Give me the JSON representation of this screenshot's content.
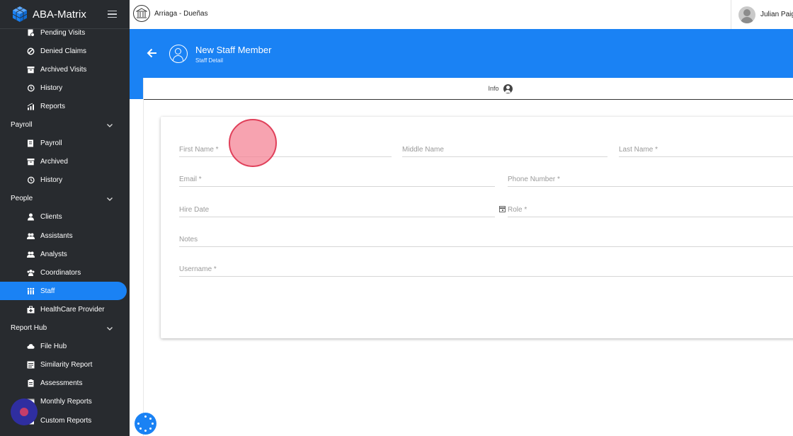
{
  "app": {
    "name": "ABA-Matrix"
  },
  "sidebar": {
    "items": [
      {
        "label": "Pending Visits",
        "icon": "pending-visits-icon"
      },
      {
        "label": "Denied Claims",
        "icon": "denied-icon"
      },
      {
        "label": "Archived Visits",
        "icon": "archive-icon"
      },
      {
        "label": "History",
        "icon": "history-icon"
      },
      {
        "label": "Reports",
        "icon": "reports-icon"
      }
    ],
    "payroll_section": "Payroll",
    "payroll_items": [
      {
        "label": "Payroll",
        "icon": "payroll-icon"
      },
      {
        "label": "Archived",
        "icon": "archive-icon"
      },
      {
        "label": "History",
        "icon": "history-icon"
      }
    ],
    "people_section": "People",
    "people_items": [
      {
        "label": "Clients",
        "icon": "client-icon"
      },
      {
        "label": "Assistants",
        "icon": "assistants-icon"
      },
      {
        "label": "Analysts",
        "icon": "analysts-icon"
      },
      {
        "label": "Coordinators",
        "icon": "coordinators-icon"
      },
      {
        "label": "Staff",
        "icon": "staff-icon",
        "active": true
      },
      {
        "label": "HealthCare Provider",
        "icon": "healthcare-icon"
      }
    ],
    "reporthub_section": "Report Hub",
    "reporthub_items": [
      {
        "label": "File Hub",
        "icon": "cloud-icon"
      },
      {
        "label": "Similarity Report",
        "icon": "similarity-icon"
      },
      {
        "label": "Assessments",
        "icon": "assessments-icon"
      },
      {
        "label": "Monthly Reports",
        "icon": "monthly-icon"
      },
      {
        "label": "Custom Reports",
        "icon": "custom-reports-icon"
      }
    ]
  },
  "topbar": {
    "org_name": "Arriaga - Dueñas",
    "user_name": "Julian Paig"
  },
  "header": {
    "title": "New Staff Member",
    "subtitle": "Staff Detail"
  },
  "tab": {
    "label": "Info",
    "icon": "account-circle-icon"
  },
  "form": {
    "first_name": "First Name *",
    "middle_name": "Middle Name",
    "last_name": "Last Name *",
    "email": "Email *",
    "phone": "Phone Number *",
    "hire_date": "Hire Date",
    "role": "Role *",
    "notes": "Notes",
    "username": "Username *"
  },
  "colors": {
    "primary": "#1a82f4",
    "sidebar_bg": "#282b2f",
    "touch_indicator": "#f48496"
  }
}
